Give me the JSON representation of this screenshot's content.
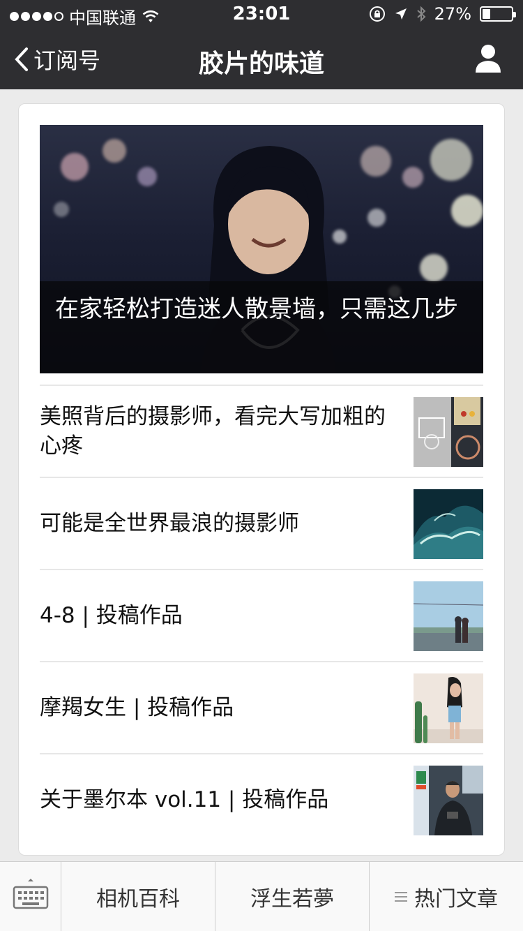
{
  "status_bar": {
    "carrier": "中国联通",
    "time": "23:01",
    "battery": "27%",
    "battery_level": 0.27,
    "signal_bars": 4,
    "icons": [
      "wifi-icon",
      "orientation-lock-icon",
      "location-arrow-icon",
      "bluetooth-icon",
      "battery-icon"
    ]
  },
  "nav": {
    "back_label": "订阅号",
    "title": "胶片的味道",
    "profile_icon": "person-icon"
  },
  "hero": {
    "caption": "在家轻松打造迷人散景墙，只需这几步"
  },
  "articles": [
    {
      "title": "美照背后的摄影师，看完大写加粗的心疼",
      "thumb": "basketball-hoop-photo"
    },
    {
      "title": "可能是全世界最浪的摄影师",
      "thumb": "ocean-wave-photo"
    },
    {
      "title": "4-8 | 投稿作品",
      "thumb": "couple-on-road-photo"
    },
    {
      "title": "摩羯女生 | 投稿作品",
      "thumb": "girl-with-cactus-photo"
    },
    {
      "title": "关于墨尔本 vol.11 | 投稿作品",
      "thumb": "man-with-camera-photo"
    }
  ],
  "menu": {
    "keyboard_icon": "keyboard-icon",
    "items": [
      "相机百科",
      "浮生若夢",
      "热门文章"
    ],
    "list_icon": "list-icon"
  },
  "colors": {
    "header_bg": "#2e2e31",
    "page_bg": "#ebebeb",
    "card_bg": "#ffffff",
    "divider": "#e7e7e7"
  }
}
